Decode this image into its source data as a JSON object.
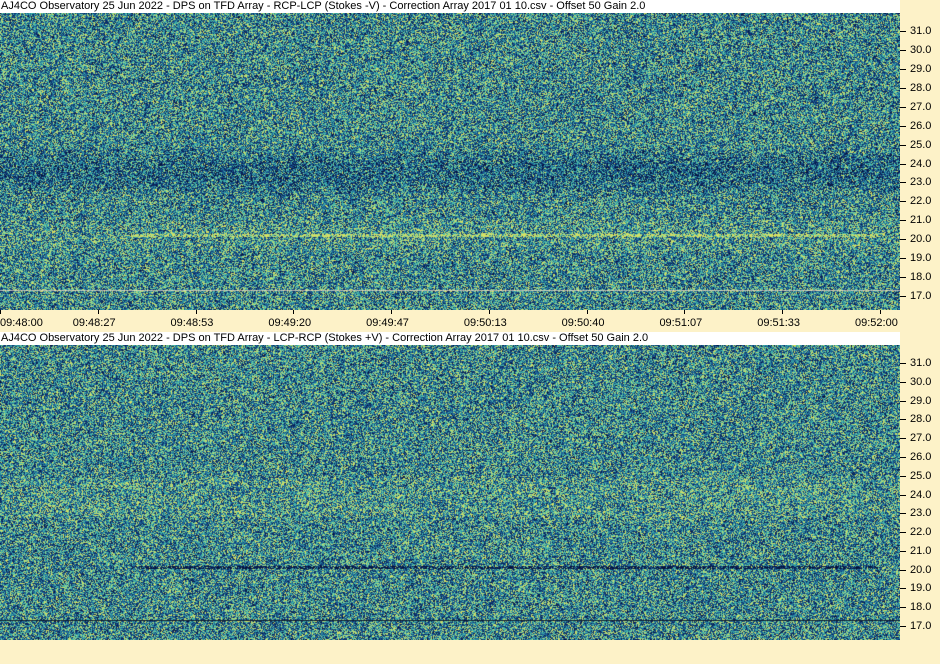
{
  "panels": [
    {
      "title": "AJ4CO Observatory 25 Jun 2022  -  DPS on TFD Array  -  RCP-LCP (Stokes -V)  -  Correction Array 2017 01 10.csv  -  Offset 50  Gain 2.0"
    },
    {
      "title": "AJ4CO Observatory 25 Jun 2022  -  DPS on TFD Array  -  LCP-RCP (Stokes +V)  -  Correction Array 2017 01 10.csv  -  Offset 50  Gain 2.0"
    }
  ],
  "freq_ticks": [
    "31.0",
    "30.0",
    "29.0",
    "28.0",
    "27.0",
    "26.0",
    "25.0",
    "24.0",
    "23.0",
    "22.0",
    "21.0",
    "20.0",
    "19.0",
    "18.0",
    "17.0"
  ],
  "time_ticks": [
    "09:48:00",
    "09:48:27",
    "09:48:53",
    "09:49:20",
    "09:49:47",
    "09:50:13",
    "09:50:40",
    "09:51:07",
    "09:51:33",
    "09:52:00"
  ],
  "colors": {
    "background": "#fdf2c8",
    "spectrogram_dark": "#0a1f4a",
    "spectrogram_mid": "#1c5a8a",
    "spectrogram_cyan": "#3fb8b0",
    "spectrogram_yellow": "#d8e060"
  }
}
